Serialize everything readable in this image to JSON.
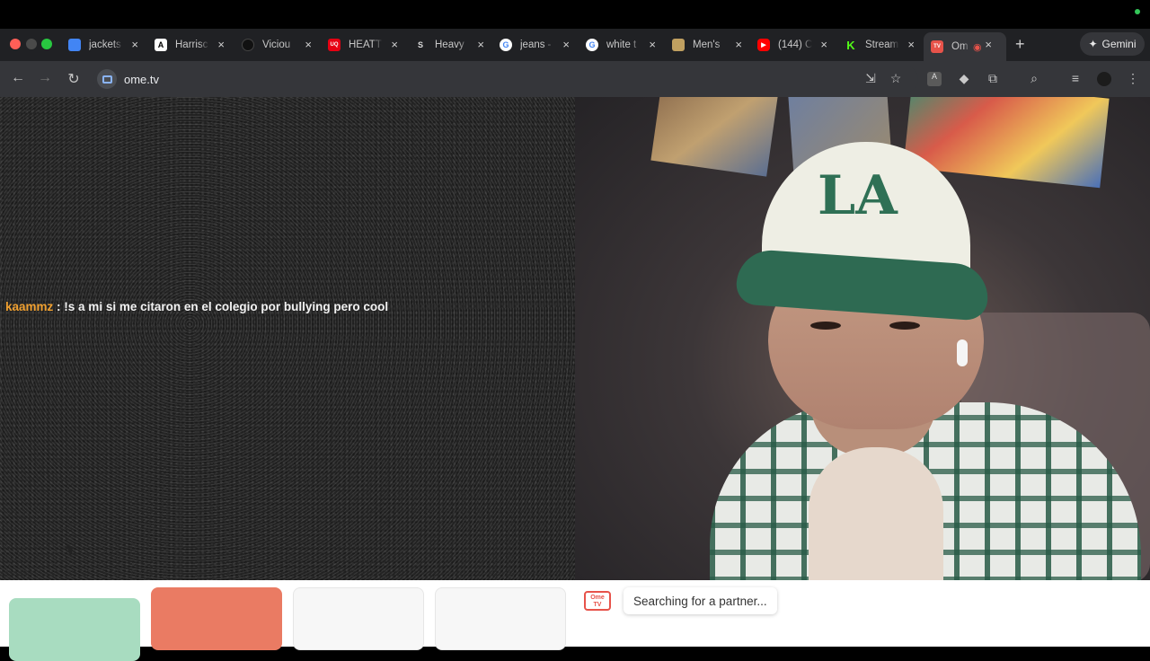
{
  "browser": {
    "tabs": [
      {
        "title": "jackets",
        "icon": "shopping-favicon",
        "color": "#4285f4"
      },
      {
        "title": "Harrisc",
        "icon": "a-favicon",
        "color": "#ffffff"
      },
      {
        "title": "Viciou",
        "icon": "dark-circle-favicon",
        "color": "#111111"
      },
      {
        "title": "HEATT",
        "icon": "uniqlo-favicon",
        "color": "#e60012"
      },
      {
        "title": "Heavy",
        "icon": "s-favicon",
        "color": "#222222"
      },
      {
        "title": "jeans -",
        "icon": "google-favicon",
        "color": "#ffffff"
      },
      {
        "title": "white t",
        "icon": "google-favicon",
        "color": "#ffffff"
      },
      {
        "title": "Men's",
        "icon": "store-favicon",
        "color": "#c0a060"
      },
      {
        "title": "(144) C",
        "icon": "youtube-favicon",
        "color": "#ff0000"
      },
      {
        "title": "Stream",
        "icon": "kick-favicon",
        "color": "#53fc18"
      },
      {
        "title": "Om",
        "icon": "ometv-favicon",
        "color": "#e7534a"
      }
    ],
    "gemini_label": "Gemini",
    "url": "ome.tv"
  },
  "chat": {
    "username": "kaammz",
    "separator": " : ",
    "message": "!s a mi si me citaron en el colegio por bullying pero cool"
  },
  "self_video": {
    "cap_logo": "LA"
  },
  "panel": {
    "logo_text": "Ome TV",
    "status": "Searching for a partner..."
  },
  "colors": {
    "start_button": "#a8dcc0",
    "stop_button": "#ea7b63",
    "username": "#f0a030"
  }
}
